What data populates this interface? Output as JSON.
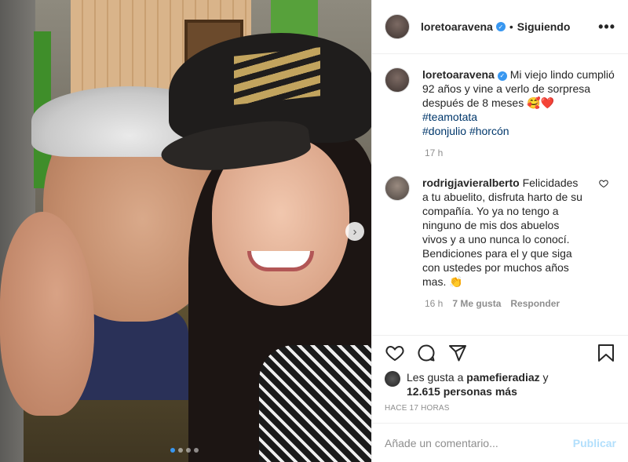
{
  "post": {
    "carousel": {
      "total_slides": 4,
      "active_slide": 1
    }
  },
  "header": {
    "username": "loretoaravena",
    "separator": "•",
    "following_label": "Siguiendo",
    "more_icon": "more-horizontal-icon",
    "more_label": "•••"
  },
  "caption": {
    "username": "loretoaravena",
    "text": "Mi viejo lindo cumplió 92 años y vine a verlo de sorpresa después de 8 meses 🥰❤️",
    "hashtags": [
      "#teamotata",
      "#donjulio #horcón"
    ],
    "time": "17 h"
  },
  "comment": {
    "username": "rodrigjavieralberto",
    "text": "Felicidades a tu abuelito, disfruta harto de su compañía. Yo ya no tengo a ninguno de mis dos abuelos vivos y a uno nunca lo conocí. Bendiciones para el y que siga con ustedes por muchos años mas. 👏",
    "time": "16 h",
    "likes": "7 Me gusta",
    "reply": "Responder"
  },
  "likes": {
    "prefix": "Les gusta a",
    "user": "pamefieradiaz",
    "connector": "y",
    "count": "12.615 personas más"
  },
  "timestamp": "HACE 17 HORAS",
  "add_comment": {
    "placeholder": "Añade un comentario...",
    "publish_label": "Publicar"
  },
  "colors": {
    "accent": "#3897f0",
    "publish_disabled": "#b2dffc",
    "hashtag": "#00376b"
  }
}
